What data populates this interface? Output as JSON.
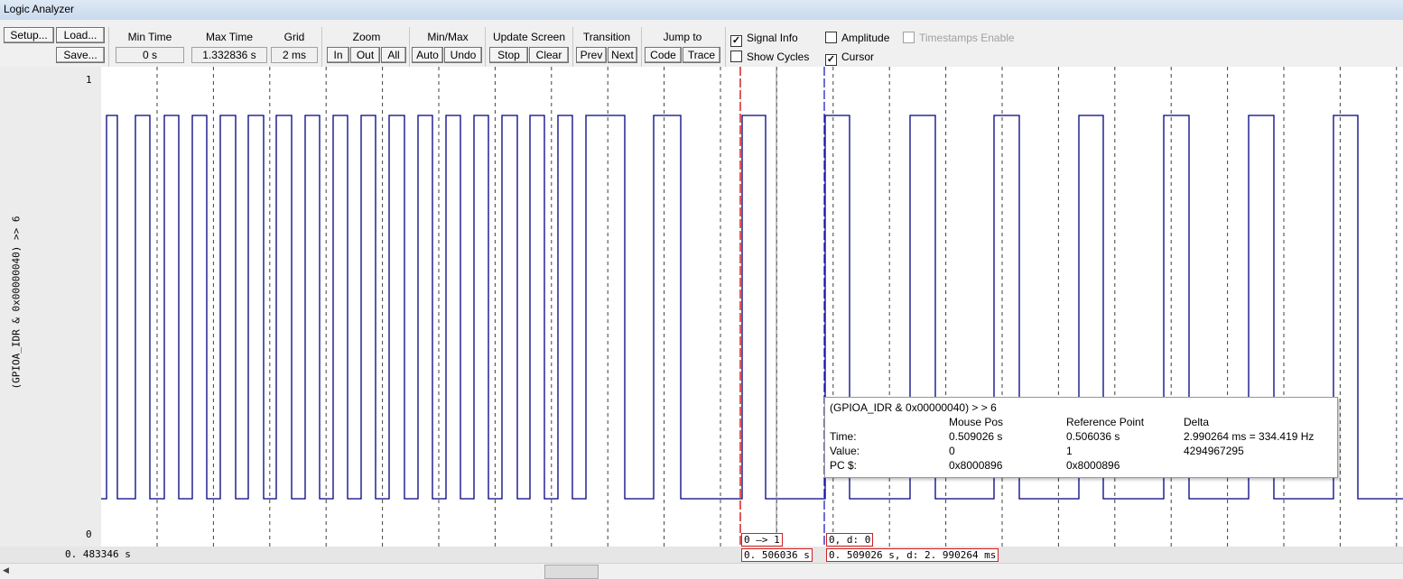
{
  "window": {
    "title": "Logic Analyzer"
  },
  "toolbar": {
    "setup": "Setup...",
    "load": "Load...",
    "save": "Save...",
    "min_time": {
      "label": "Min Time",
      "value": "0 s"
    },
    "max_time": {
      "label": "Max Time",
      "value": "1.332836 s"
    },
    "grid": {
      "label": "Grid",
      "value": "2 ms"
    },
    "zoom": {
      "label": "Zoom",
      "in": "In",
      "out": "Out",
      "all": "All"
    },
    "minmax": {
      "label": "Min/Max",
      "auto": "Auto",
      "undo": "Undo"
    },
    "update": {
      "label": "Update Screen",
      "stop": "Stop",
      "clear": "Clear"
    },
    "transition": {
      "label": "Transition",
      "prev": "Prev",
      "next": "Next"
    },
    "jump": {
      "label": "Jump to",
      "code": "Code",
      "trace": "Trace"
    },
    "options": {
      "signal_info": {
        "label": "Signal Info",
        "checked": true
      },
      "amplitude": {
        "label": "Amplitude",
        "checked": false
      },
      "timestamps": {
        "label": "Timestamps Enable",
        "checked": false,
        "enabled": false
      },
      "show_cycles": {
        "label": "Show Cycles",
        "checked": false
      },
      "cursor": {
        "label": "Cursor",
        "checked": true
      }
    }
  },
  "signal": {
    "name": "(GPIOA_IDR & 0x00000040) >> 6",
    "y_max": "1",
    "y_min": "0",
    "colors": {
      "trace": "#00007f",
      "grid": "#404040",
      "reference_cursor": "#d00000",
      "mouse_cursor": "#2020c0"
    }
  },
  "popup": {
    "title": "(GPIOA_IDR & 0x00000040) > > 6",
    "headers": [
      "Mouse Pos",
      "Reference Point",
      "Delta"
    ],
    "rows": [
      {
        "label": "Time:",
        "mouse": "0.509026 s",
        "ref": "0.506036 s",
        "delta": "2.990264 ms = 334.419 Hz"
      },
      {
        "label": "Value:",
        "mouse": "0",
        "ref": "1",
        "delta": "4294967295"
      },
      {
        "label": "PC $:",
        "mouse": "0x8000896",
        "ref": "0x8000896",
        "delta": ""
      }
    ]
  },
  "readouts": {
    "start_time": "0. 483346  s",
    "ref_transition": "0 —> 1",
    "ref_time": "0. 506036  s",
    "mouse_value": "0,   d:  0",
    "mouse_time": "0. 509026  s,    d:  2. 990264  ms"
  }
}
